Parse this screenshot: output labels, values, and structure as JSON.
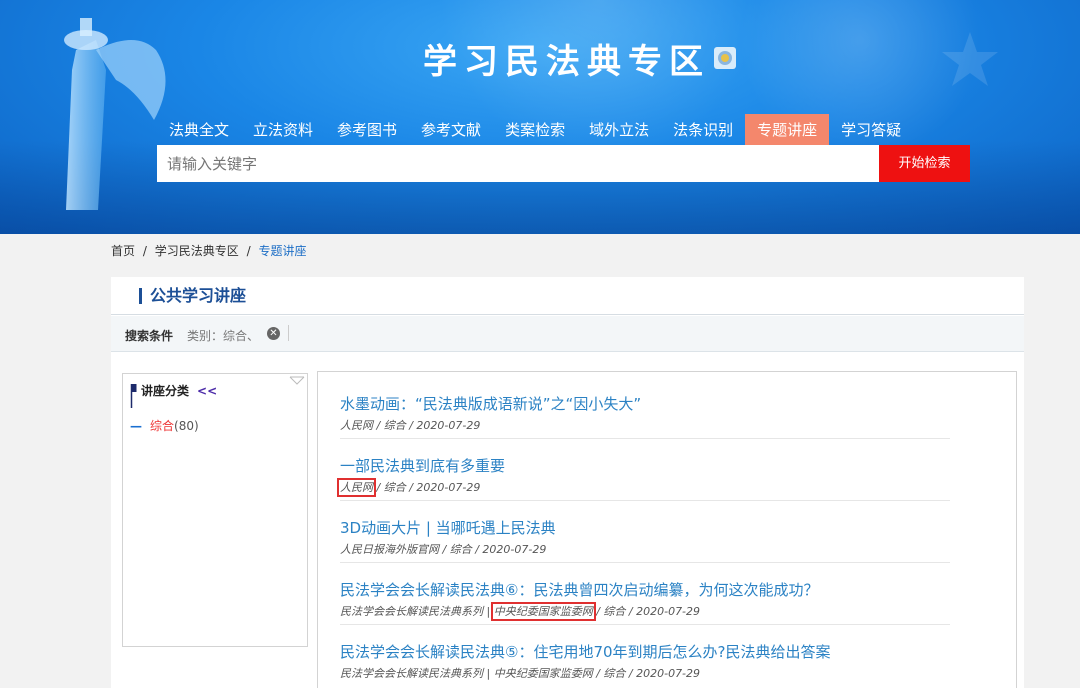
{
  "banner": {
    "title": "学习民法典专区"
  },
  "nav": {
    "items": [
      "法典全文",
      "立法资料",
      "参考图书",
      "参考文献",
      "类案检索",
      "域外立法",
      "法条识别",
      "专题讲座",
      "学习答疑"
    ],
    "active_index": 7
  },
  "search": {
    "placeholder": "请输入关键字",
    "button_label": "开始检索"
  },
  "breadcrumb": {
    "home": "首页",
    "sep1": "/",
    "section": "学习民法典专区",
    "sep2": "/",
    "current": "专题讲座"
  },
  "card": {
    "title": "公共学习讲座"
  },
  "filter": {
    "label": "搜索条件",
    "value": "类别：综合、",
    "clear_icon": "x-circle-icon"
  },
  "sidebar": {
    "title": "讲座分类",
    "collapse_label": "<<",
    "category": {
      "dash": "—",
      "name": "综合",
      "count": "(80)"
    }
  },
  "lectures": [
    {
      "title": "水墨动画：“民法典版成语新说”之“因小失大”",
      "source": "人民网",
      "rest": " / 综合 / 2020-07-29",
      "highlight_source": false
    },
    {
      "title": "一部民法典到底有多重要",
      "source": "人民网",
      "rest": " / 综合 / 2020-07-29",
      "highlight_source": true
    },
    {
      "title": "3D动画大片 | 当哪吒遇上民法典",
      "source": "人民日报海外版官网",
      "rest": " / 综合 / 2020-07-29",
      "highlight_source": false
    },
    {
      "title": "民法学会会长解读民法典⑥：民法典曾四次启动编纂，为何这次能成功？",
      "series": "民法学会会长解读民法典系列 | ",
      "source": "中央纪委国家监委网",
      "rest": " / 综合 / 2020-07-29",
      "highlight_source": true
    },
    {
      "title": "民法学会会长解读民法典⑤：住宅用地70年到期后怎么办?民法典给出答案",
      "series": "民法学会会长解读民法典系列 | ",
      "source": "中央纪委国家监委网",
      "rest": " / 综合 / 2020-07-29",
      "highlight_source": false
    }
  ],
  "colors": {
    "banner": "#1a86e6",
    "nav_active": "#f4876c",
    "search_button": "#ee1111",
    "link": "#2b82c4",
    "highlight_box": "#e03030"
  }
}
